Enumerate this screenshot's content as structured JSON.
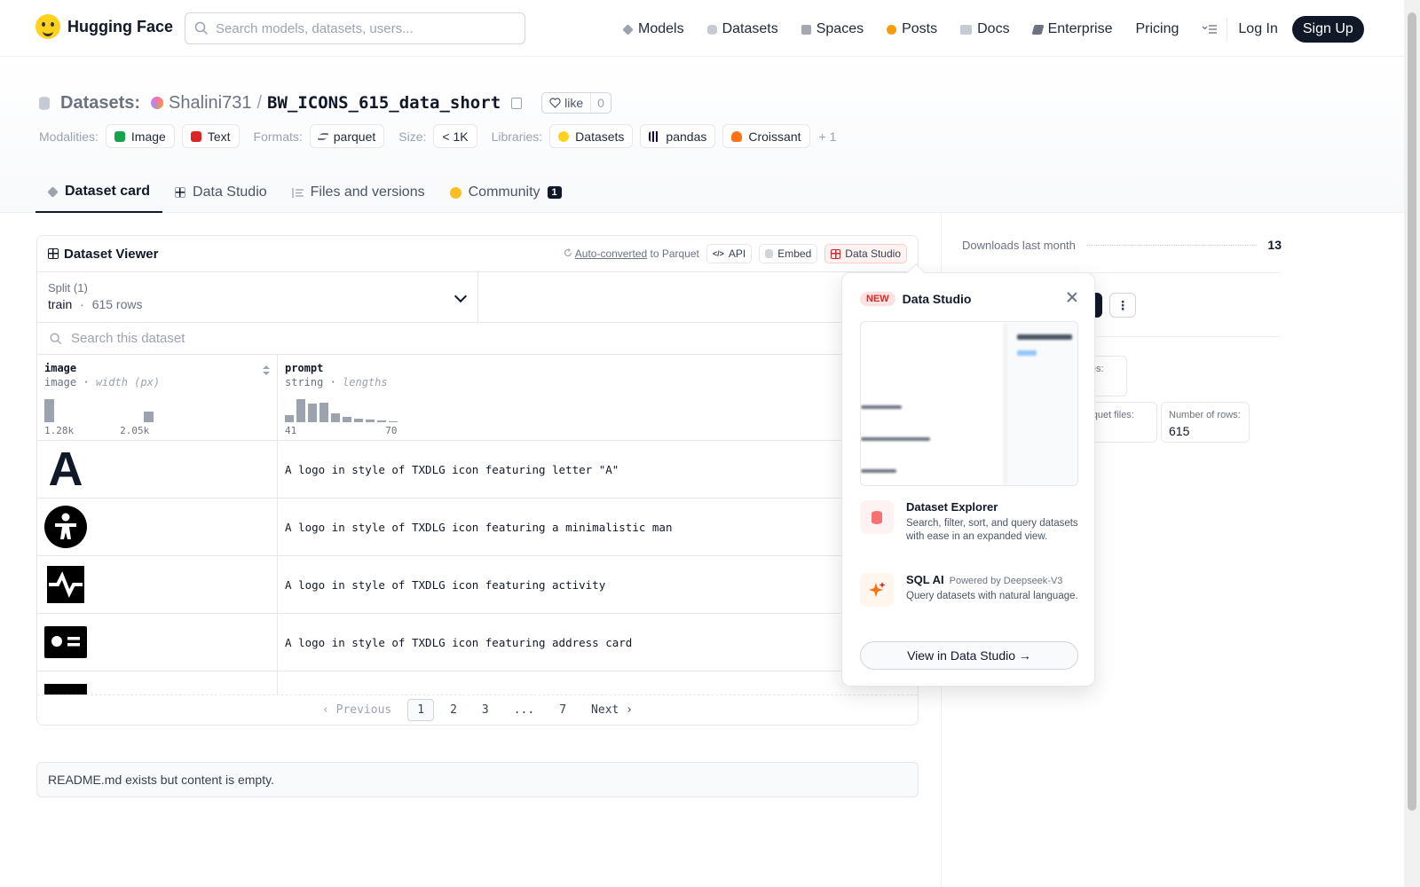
{
  "header": {
    "logo_text": "Hugging Face",
    "search_placeholder": "Search models, datasets, users...",
    "nav": [
      {
        "label": "Models",
        "color": "#9ca3af"
      },
      {
        "label": "Datasets",
        "color": "#c5cad3"
      },
      {
        "label": "Spaces",
        "color": "#a3a8b1"
      },
      {
        "label": "Posts",
        "color": "#f59e0b"
      },
      {
        "label": "Docs",
        "color": "#c5cad3"
      },
      {
        "label": "Enterprise",
        "color": "#6b7280"
      },
      {
        "label": "Pricing",
        "color": ""
      }
    ],
    "login": "Log In",
    "signup": "Sign Up"
  },
  "repo": {
    "category": "Datasets:",
    "owner": "Shalini731",
    "separator": "/",
    "name": "BW_ICONS_615_data_short",
    "like_label": "like",
    "like_count": "0",
    "modalities_label": "Modalities:",
    "modalities": [
      "Image",
      "Text"
    ],
    "formats_label": "Formats:",
    "format": "parquet",
    "size_label": "Size:",
    "size": "< 1K",
    "libraries_label": "Libraries:",
    "libraries": [
      "Datasets",
      "pandas",
      "Croissant"
    ],
    "libraries_more": "+ 1"
  },
  "tabs": [
    {
      "label": "Dataset card",
      "active": true
    },
    {
      "label": "Data Studio",
      "active": false
    },
    {
      "label": "Files and versions",
      "active": false
    },
    {
      "label": "Community",
      "active": false,
      "badge": "1"
    }
  ],
  "viewer": {
    "title": "Dataset Viewer",
    "auto_converted": "Auto-converted",
    "to_parquet": "to Parquet",
    "api": "API",
    "embed": "Embed",
    "data_studio": "Data Studio",
    "split_label": "Split (1)",
    "split_value": "train",
    "split_dot": "·",
    "split_rows": "615 rows",
    "search_placeholder": "Search this dataset",
    "columns": [
      {
        "name": "image",
        "type": "image",
        "stat": "width (px)",
        "min": "1.28k",
        "max": "2.05k",
        "hist": [
          1.0,
          0,
          0,
          0,
          0,
          0,
          0,
          0,
          0.45
        ]
      },
      {
        "name": "prompt",
        "type": "string",
        "stat": "lengths",
        "min": "41",
        "max": "70",
        "hist": [
          0.3,
          1.0,
          0.8,
          0.85,
          0.4,
          0.22,
          0.15,
          0.1,
          0.06,
          0.04
        ]
      }
    ],
    "rows": [
      {
        "icon": "letter-a-icon",
        "prompt": "A logo in style of TXDLG icon featuring letter \"A\""
      },
      {
        "icon": "minimalistic-man-icon",
        "prompt": "A logo in style of TXDLG icon featuring a minimalistic man"
      },
      {
        "icon": "activity-icon",
        "prompt": "A logo in style of TXDLG icon featuring activity"
      },
      {
        "icon": "address-card-icon",
        "prompt": "A logo in style of TXDLG icon featuring address card"
      }
    ],
    "pager": {
      "previous": "Previous",
      "pages": [
        "1",
        "2",
        "3",
        "...",
        "7"
      ],
      "current": "1",
      "next": "Next"
    }
  },
  "readme": "README.md exists but content is empty.",
  "sidebar": {
    "downloads_label": "Downloads last month",
    "downloads_value": "13",
    "stat1_label": "files:",
    "stat2_label": "arquet files:",
    "stat3_label": "Number of rows:",
    "stat3_value": "615"
  },
  "popover": {
    "new_badge": "NEW",
    "title": "Data Studio",
    "features": [
      {
        "title": "Dataset Explorer",
        "sub": "",
        "desc": "Search, filter, sort, and query datasets with ease in an expanded view."
      },
      {
        "title": "SQL AI",
        "sub": "Powered by Deepseek-V3",
        "desc": "Query datasets with natural language."
      }
    ],
    "button": "View in Data Studio →"
  }
}
